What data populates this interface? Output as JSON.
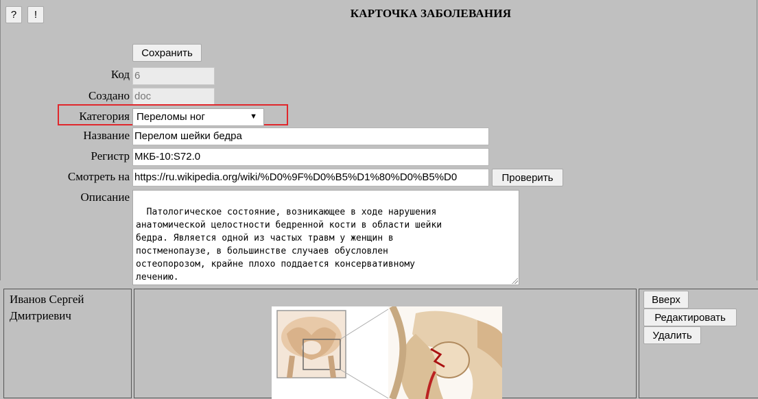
{
  "toolbar": {
    "help_label": "?",
    "alert_label": "!"
  },
  "page": {
    "title": "КАРТОЧКА ЗАБОЛЕВАНИЯ"
  },
  "form": {
    "save_label": "Сохранить",
    "code": {
      "label": "Код",
      "value": "6"
    },
    "created": {
      "label": "Создано",
      "value": "doc"
    },
    "category": {
      "label": "Категория",
      "value": "Переломы ног"
    },
    "name": {
      "label": "Название",
      "value": "Перелом шейки бедра"
    },
    "register": {
      "label": "Регистр",
      "value": "МКБ-10:S72.0"
    },
    "link": {
      "label": "Смотреть на",
      "value": "https://ru.wikipedia.org/wiki/%D0%9F%D0%B5%D1%80%D0%B5%D0",
      "check_label": "Проверить"
    },
    "description": {
      "label": "Описание",
      "value": "Патологическое состояние, возникающее в ходе нарушения\nанатомической целостности бедренной кости в области шейки\nбедра. Является одной из частых травм у женщин в\nпостменопаузе, в большинстве случаев обусловлен\nостеопорозом, крайне плохо поддается консервативному\nлечению."
    }
  },
  "author": {
    "name_line1": "Иванов Сергей",
    "name_line2": "Дмитриевич"
  },
  "actions": {
    "up_label": "Вверх",
    "edit_label": "Редактировать",
    "delete_label": "Удалить"
  },
  "colors": {
    "highlight": "#e0262b",
    "background": "#c0c0c0"
  }
}
